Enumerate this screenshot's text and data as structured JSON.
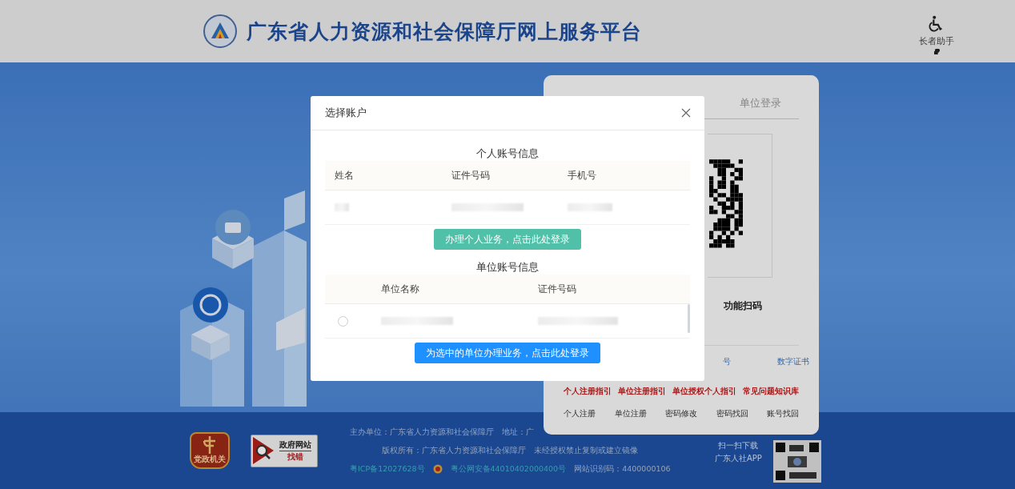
{
  "header": {
    "title": "广东省人力资源和社会保障厅网上服务平台",
    "assistant_label": "长者助手"
  },
  "login_card": {
    "tabs": [
      {
        "label": "单位登录",
        "selected": false
      }
    ],
    "qr_hint": "功能扫码",
    "links": [
      "号",
      "数字证书"
    ],
    "guide_links": [
      "个人注册指引",
      "单位注册指引",
      "单位授权个人指引",
      "常见问题知识库"
    ],
    "bottom_links": [
      "个人注册",
      "单位注册",
      "密码修改",
      "密码找回",
      "账号找回"
    ]
  },
  "footer": {
    "badge_label": "党政机关",
    "report_title": "政府网站",
    "report_action": "找错",
    "lines": [
      [
        {
          "kind": "text",
          "text": "主办单位：广东省人力资源和社会保障厅"
        },
        {
          "kind": "text",
          "text": "地址：广"
        }
      ],
      [
        {
          "kind": "text",
          "text": "版权所有：广东省人力资源和社会保障厅"
        },
        {
          "kind": "text",
          "text": "未经授权禁止复制或建立镜像"
        }
      ],
      [
        {
          "kind": "link",
          "text": "粤ICP备12027628号"
        },
        {
          "kind": "police",
          "text": "粤公网安备44010402000400号"
        },
        {
          "kind": "text",
          "text": "网站识别码：4400000106"
        }
      ]
    ],
    "app_lines": [
      "扫一扫下载",
      "广东人社APP"
    ]
  },
  "modal": {
    "title": "选择账户",
    "personal": {
      "heading": "个人账号信息",
      "columns": [
        "姓名",
        "证件号码",
        "手机号"
      ],
      "rows": [
        {
          "kind": "blurred"
        }
      ],
      "button": "办理个人业务，点击此处登录"
    },
    "company": {
      "heading": "单位账号信息",
      "columns": [
        "单位名称",
        "证件号码"
      ],
      "rows": [
        {
          "kind": "blurred",
          "selected": false
        }
      ],
      "button": "为选中的单位办理业务，点击此处登录"
    }
  }
}
